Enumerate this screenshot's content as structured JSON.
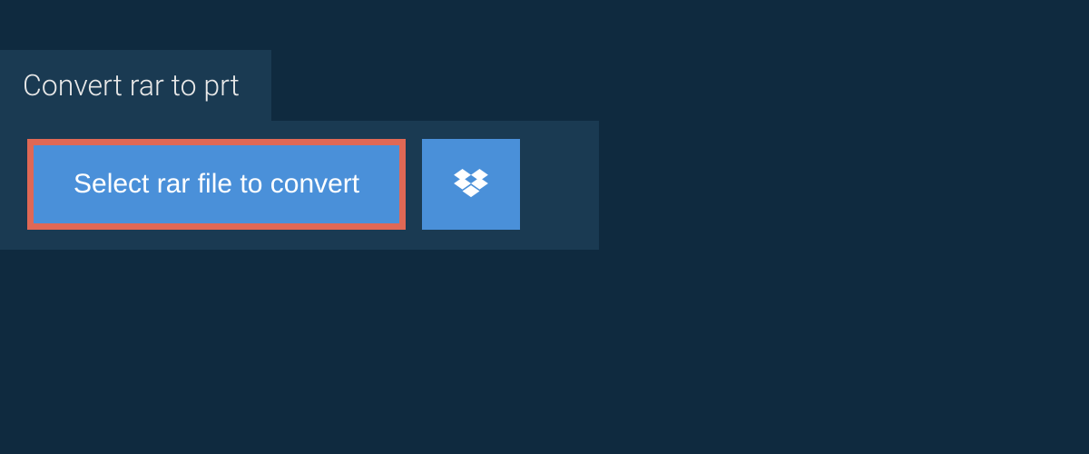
{
  "header": {
    "title": "Convert rar to prt"
  },
  "actions": {
    "select_file_label": "Select rar file to convert"
  },
  "colors": {
    "background": "#0f2a3f",
    "panel": "#1a3a52",
    "button": "#4a90d9",
    "highlight_border": "#e06855",
    "text_light": "#e8e8e8",
    "text_white": "#ffffff"
  }
}
